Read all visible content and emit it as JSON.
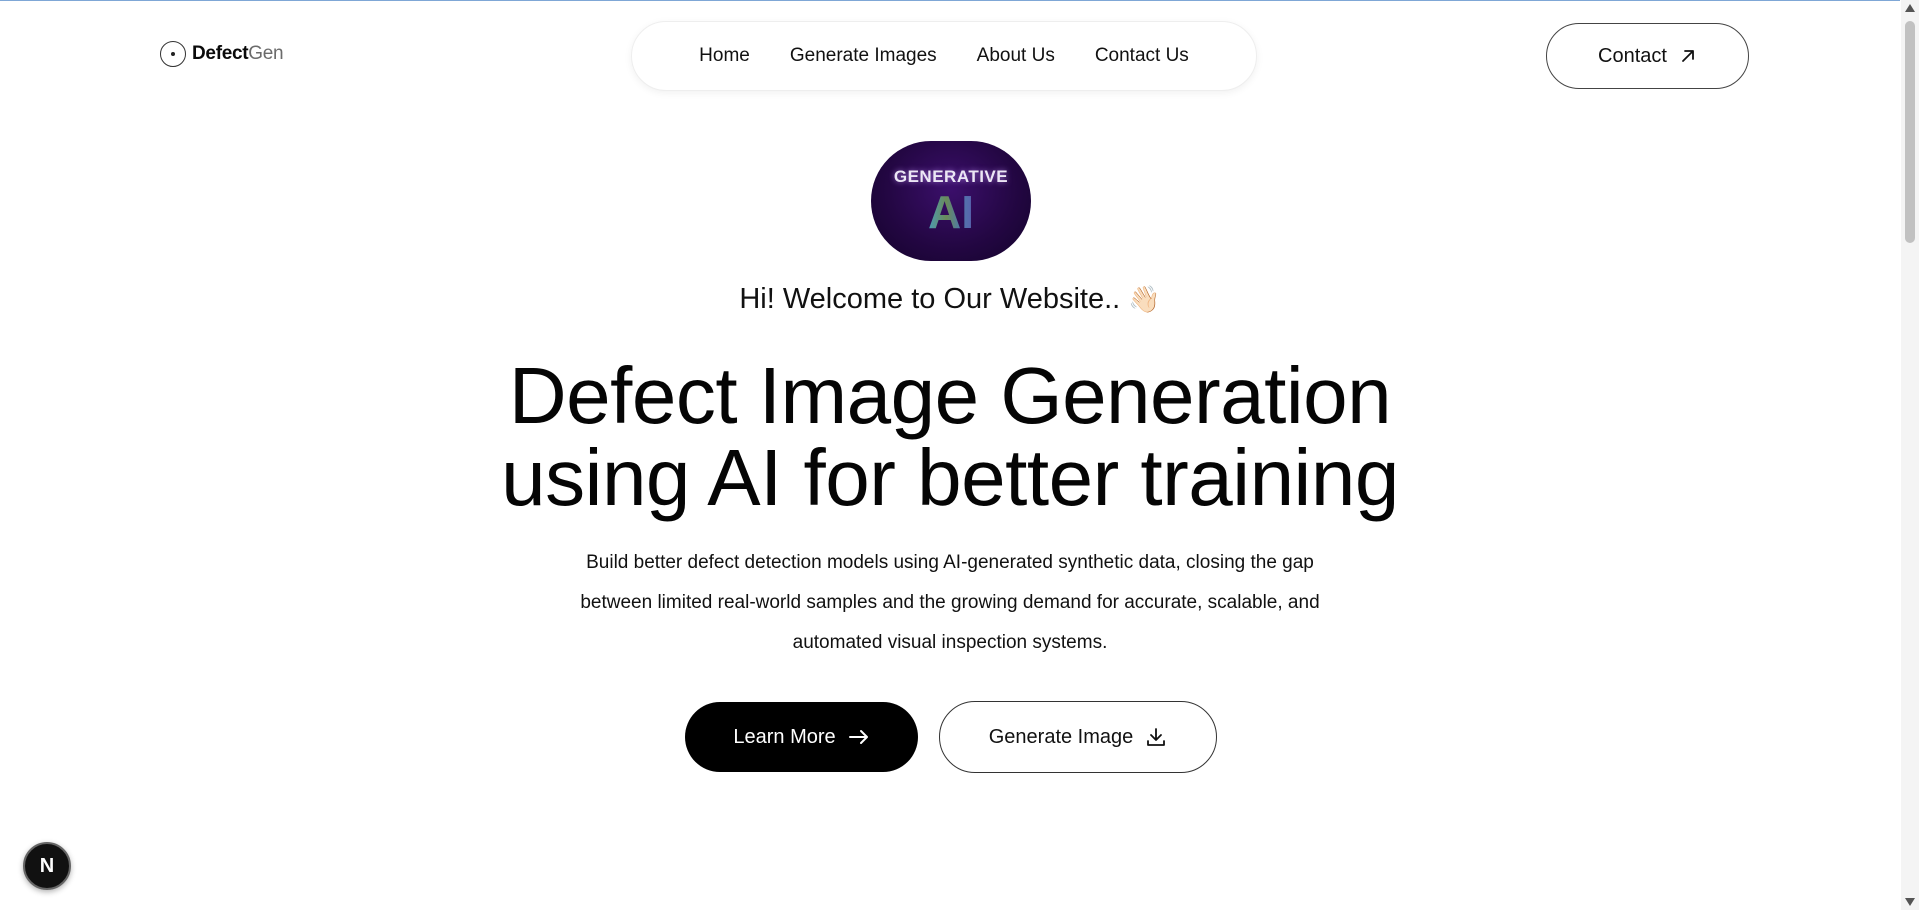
{
  "header": {
    "logo_primary": "Defect",
    "logo_secondary": "Gen",
    "nav": [
      "Home",
      "Generate Images",
      "About Us",
      "Contact Us"
    ],
    "contact_label": "Contact"
  },
  "hero": {
    "badge_top": "GENERATIVE",
    "badge_ai": "AI",
    "welcome": "Hi! Welcome to Our Website..",
    "welcome_emoji": "👋🏻",
    "headline_line1": "Defect Image Generation",
    "headline_line2": "using AI for better training",
    "subtext_line1": "Build better defect detection models using AI-generated synthetic data, closing the gap",
    "subtext_line2": "between limited real-world samples and the growing demand for accurate, scalable, and",
    "subtext_line3": "automated visual inspection systems.",
    "primary_button": "Learn More",
    "secondary_button": "Generate Image"
  },
  "dev_badge": "N",
  "icons": {
    "contact": "arrow-up-right-icon",
    "primary": "arrow-right-icon",
    "secondary": "download-icon"
  },
  "colors": {
    "primary_button_bg": "#000000",
    "badge_bg": "#240744"
  }
}
